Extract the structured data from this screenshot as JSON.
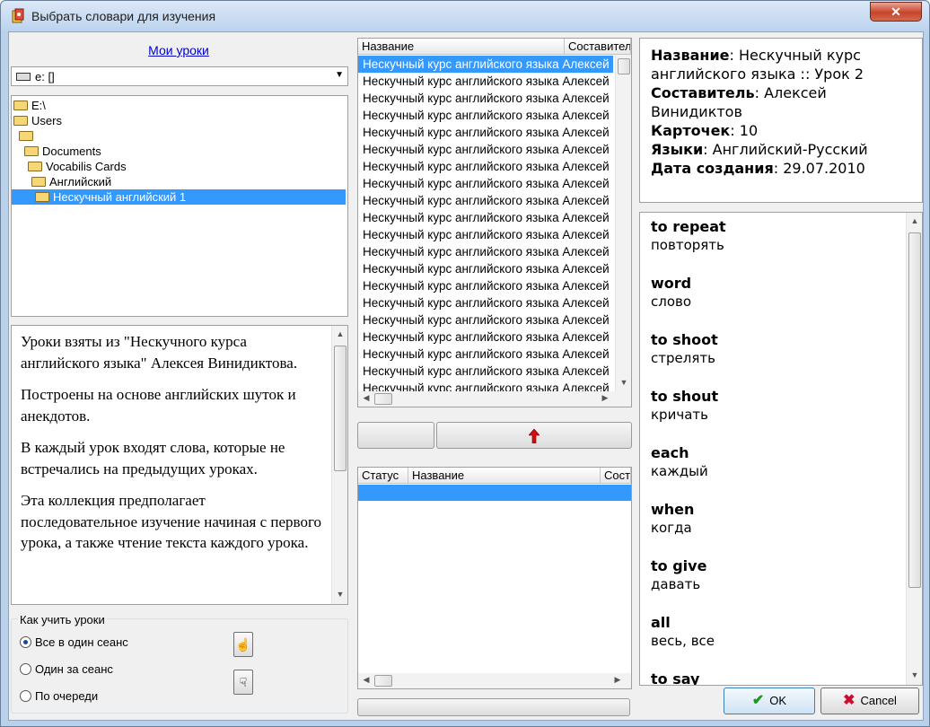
{
  "window": {
    "title": "Выбрать словари для изучения"
  },
  "left": {
    "my_lessons_link": "Мои уроки",
    "drive_value": "e: []",
    "tree": [
      {
        "label": "E:\\",
        "selected": false
      },
      {
        "label": "Users",
        "selected": false
      },
      {
        "label": "",
        "selected": false
      },
      {
        "label": "Documents",
        "selected": false
      },
      {
        "label": "Vocabilis Cards",
        "selected": false
      },
      {
        "label": "Английский",
        "selected": false
      },
      {
        "label": "Нескучный английский 1",
        "selected": true
      }
    ],
    "description": [
      "Уроки взяты из \"Нескучного курса английского языка\" Алексея Винидиктова.",
      "Построены на основе английских шуток и анекдотов.",
      "В каждый урок входят слова, которые не встречались на предыдущих уроках.",
      "Эта коллекция предполагает последовательное изучение начиная с первого урока, а также чтение текста каждого урока."
    ],
    "how_to_study": {
      "label": "Как учить уроки",
      "options": [
        {
          "label": "Все в один сеанс",
          "checked": true
        },
        {
          "label": "Один за сеанс",
          "checked": false
        },
        {
          "label": "По очереди",
          "checked": false
        }
      ]
    }
  },
  "middle": {
    "top_list": {
      "columns": [
        "Название",
        "Составитель"
      ],
      "row_text": "Нескучный курс английского языка Алексей Винидиктов",
      "row_count": 20,
      "selected_index": 0
    },
    "bottom_list": {
      "columns": [
        "Статус",
        "Название",
        "Составитель"
      ]
    }
  },
  "right": {
    "info": [
      {
        "key": "Название",
        "value": "Нескучный курс английского языка :: Урок 2"
      },
      {
        "key": "Составитель",
        "value": "Алексей Винидиктов"
      },
      {
        "key": "Карточек",
        "value": "10"
      },
      {
        "key": "Языки",
        "value": "Английский-Русский"
      },
      {
        "key": "Дата создания",
        "value": "29.07.2010"
      }
    ],
    "words": [
      {
        "word": "to repeat",
        "translation": "повторять"
      },
      {
        "word": "word",
        "translation": "слово"
      },
      {
        "word": "to shoot",
        "translation": "стрелять"
      },
      {
        "word": "to shout",
        "translation": "кричать"
      },
      {
        "word": "each",
        "translation": "каждый"
      },
      {
        "word": "when",
        "translation": "когда"
      },
      {
        "word": "to give",
        "translation": "давать"
      },
      {
        "word": "all",
        "translation": "весь, все"
      },
      {
        "word": "to say",
        "translation": ""
      }
    ]
  },
  "buttons": {
    "ok": "OK",
    "cancel": "Cancel"
  }
}
